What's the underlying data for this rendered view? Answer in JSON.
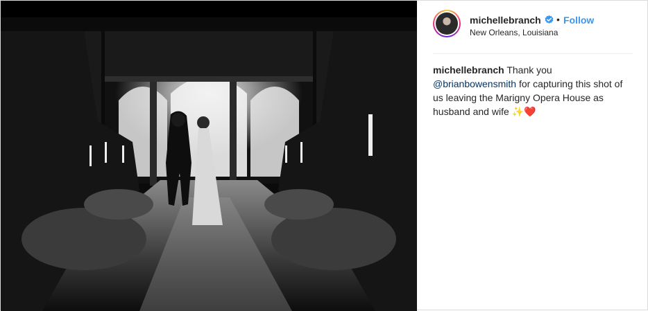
{
  "post": {
    "username": "michellebranch",
    "separator": "•",
    "follow_label": "Follow",
    "location": "New Orleans, Louisiana",
    "caption": {
      "username": "michellebranch",
      "text_before": "Thank you",
      "mention": "@brianbowensmith",
      "text_after": "for capturing this shot of us leaving the Marigny Opera House as husband and wife",
      "emoji": "✨❤️"
    }
  },
  "colors": {
    "link": "#3897f0",
    "mention": "#003569",
    "text": "#262626",
    "verified": "#3897f0"
  },
  "icons": {
    "verified": "verified-badge-icon"
  }
}
